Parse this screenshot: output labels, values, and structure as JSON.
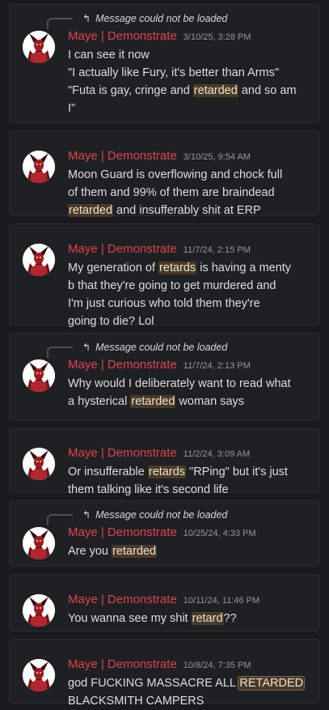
{
  "reply_notice": "Message could not be loaded",
  "reply_icon": "reply-arrow-icon",
  "colors": {
    "background": "#1a1a1e",
    "card": "#1f2024",
    "username": "#e0444c",
    "highlight": "#4a3a25",
    "timestamp": "#94979e"
  },
  "messages": [
    {
      "username": "Maye | Demonstrate",
      "timestamp": "3/10/25, 3:28 PM",
      "has_reply": true,
      "lines": [
        [
          {
            "t": "I can see it now"
          }
        ],
        [
          {
            "t": "\"I actually like Fury, it's better than Arms\""
          }
        ],
        [
          {
            "t": "\"Futa is gay, cringe and "
          },
          {
            "t": "retarded",
            "hl": true
          },
          {
            "t": " and so am"
          }
        ],
        [
          {
            "t": "I\""
          }
        ]
      ]
    },
    {
      "username": "Maye | Demonstrate",
      "timestamp": "3/10/25, 9:54 AM",
      "has_reply": false,
      "lines": [
        [
          {
            "t": "Moon Guard is overflowing and chock full"
          }
        ],
        [
          {
            "t": "of them and 99% of them are braindead"
          }
        ],
        [
          {
            "t": "retarded",
            "hl": true
          },
          {
            "t": " and insufferably shit at ERP"
          }
        ]
      ]
    },
    {
      "username": "Maye | Demonstrate",
      "timestamp": "11/7/24, 2:15 PM",
      "has_reply": false,
      "lines": [
        [
          {
            "t": "My generation of "
          },
          {
            "t": "retards",
            "hl": true
          },
          {
            "t": " is having a menty"
          }
        ],
        [
          {
            "t": "b that they're going to get murdered and"
          }
        ],
        [
          {
            "t": "I'm just curious who told them they're"
          }
        ],
        [
          {
            "t": "going to die? Lol"
          }
        ]
      ]
    },
    {
      "username": "Maye | Demonstrate",
      "timestamp": "11/7/24, 2:13 PM",
      "has_reply": true,
      "lines": [
        [
          {
            "t": "Why would I deliberately want to read what"
          }
        ],
        [
          {
            "t": "a hysterical "
          },
          {
            "t": "retarded",
            "hl": true
          },
          {
            "t": " woman says"
          }
        ]
      ]
    },
    {
      "username": "Maye | Demonstrate",
      "timestamp": "11/2/24, 3:09 AM",
      "has_reply": false,
      "lines": [
        [
          {
            "t": "Or insufferable "
          },
          {
            "t": "retards",
            "hl": true
          },
          {
            "t": " \"RPing\" but it's just"
          }
        ],
        [
          {
            "t": "them talking like it's second life"
          }
        ]
      ]
    },
    {
      "username": "Maye | Demonstrate",
      "timestamp": "10/25/24, 4:33 PM",
      "has_reply": true,
      "lines": [
        [
          {
            "t": "Are you "
          },
          {
            "t": "retarded",
            "hl": true
          }
        ]
      ]
    },
    {
      "username": "Maye | Demonstrate",
      "timestamp": "10/11/24, 11:46 PM",
      "has_reply": false,
      "lines": [
        [
          {
            "t": "You wanna see my shit "
          },
          {
            "t": "retard",
            "hl": true
          },
          {
            "t": "??"
          }
        ]
      ]
    },
    {
      "username": "Maye | Demonstrate",
      "timestamp": "10/8/24, 7:35 PM",
      "has_reply": false,
      "lines": [
        [
          {
            "t": "god FUCKING MASSACRE ALL "
          },
          {
            "t": "RETARDED",
            "hl": true,
            "box": true
          }
        ],
        [
          {
            "t": "BLACKSMITH CAMPERS"
          }
        ]
      ]
    }
  ]
}
